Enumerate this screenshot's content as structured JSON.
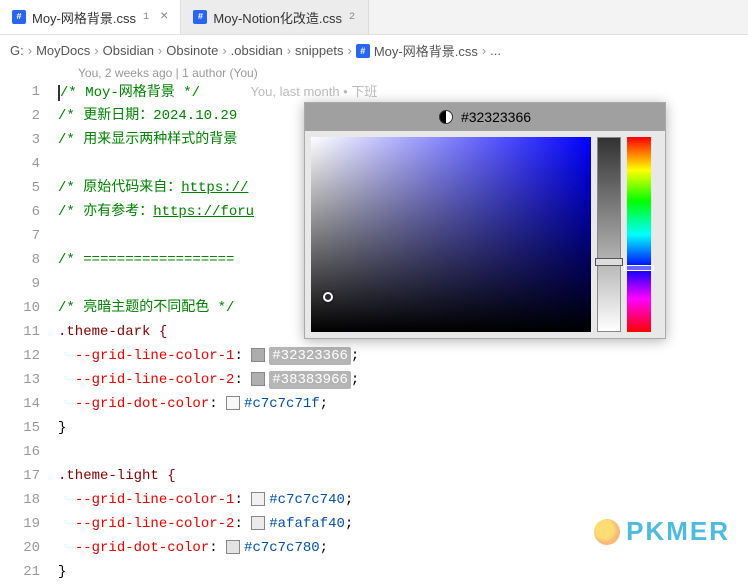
{
  "tabs": [
    {
      "name": "Moy-网格背景.css",
      "modified": "1",
      "active": true
    },
    {
      "name": "Moy-Notion化改造.css",
      "modified": "2",
      "active": false
    }
  ],
  "breadcrumb": [
    "G:",
    "MoyDocs",
    "Obsidian",
    "Obsinote",
    ".obsidian",
    "snippets",
    "Moy-网格背景.css",
    "..."
  ],
  "blame": "You, 2 weeks ago | 1 author (You)",
  "ghost_annotation": "You, last month • 下班",
  "lines": {
    "l1": "/* Moy-网格背景 */",
    "l2": "/* 更新日期：2024.10.29 ",
    "l3": "/* 用来显示两种样式的背景",
    "l5a": "/* 原始代码来自：",
    "l5b": "https://",
    "l5c": " /",
    "l6a": "/* 亦有参考：",
    "l6b": "https://foru",
    "l8": "/* ==================",
    "l10": "/* 亮暗主题的不同配色 */",
    "l11": ".theme-dark {",
    "l12p": "--grid-line-color-1",
    "l12v": "#32323366",
    "l13p": "--grid-line-color-2",
    "l13v": "#38383966",
    "l14p": "--grid-dot-color",
    "l14v": "#c7c7c71f",
    "l15": "}",
    "l17": ".theme-light {",
    "l18p": "--grid-line-color-1",
    "l18v": "#c7c7c740",
    "l19p": "--grid-line-color-2",
    "l19v": "#afafaf40",
    "l20p": "--grid-dot-color",
    "l20v": "#c7c7c780",
    "l21": "}"
  },
  "swatches": {
    "l12": "#32323366",
    "l13": "#38383966",
    "l14": "#c7c7c71f",
    "l18": "#c7c7c740",
    "l19": "#afafaf40",
    "l20": "#c7c7c780"
  },
  "picker": {
    "hex": "#32323366"
  },
  "watermark": "PKMER"
}
